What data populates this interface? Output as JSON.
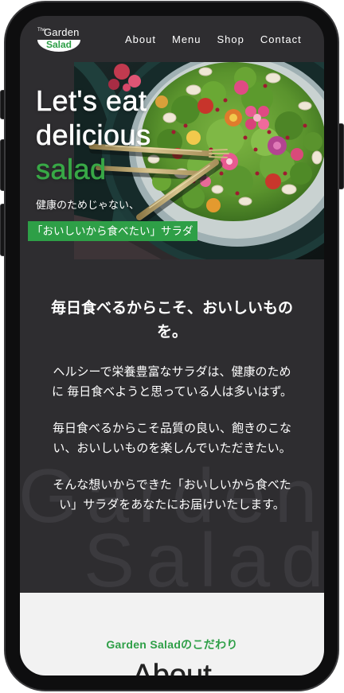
{
  "theme": {
    "page_bg": "#ffffff",
    "frame": "#0e0e0f",
    "screen_bg": "#2e2d30",
    "accent_green": "#2e9f47",
    "hero_green": "#38a846",
    "light_bg": "#f2f2f2",
    "deco_text": "#3b3a3e",
    "text_light": "#ffffff",
    "text_dark": "#222222"
  },
  "header": {
    "logo": {
      "small": "The",
      "top": "Garden",
      "bottom": "Salad"
    },
    "nav": [
      {
        "label": "About"
      },
      {
        "label": "Menu"
      },
      {
        "label": "Shop"
      },
      {
        "label": "Contact"
      }
    ]
  },
  "hero": {
    "title_lines": [
      "Let's eat",
      "delicious",
      "salad"
    ],
    "subtext": "健康のためじゃない、",
    "label": "「おいしいから食べたい」サラダ"
  },
  "intro": {
    "background_text": [
      "Garden",
      "Salad"
    ],
    "heading": "毎日食べるからこそ、おいしいものを。",
    "paragraphs": [
      "ヘルシーで栄養豊富なサラダは、健康のために 毎日食べようと思っている人は多いはず。",
      "毎日食べるからこそ品質の良い、飽きのこない、おいしいものを楽しんでいただきたい。",
      "そんな想いからできた「おいしいから食べたい」サラダをあなたにお届けいたします。"
    ]
  },
  "about": {
    "eyebrow": "Garden Saladのこだわり",
    "title": "About"
  }
}
